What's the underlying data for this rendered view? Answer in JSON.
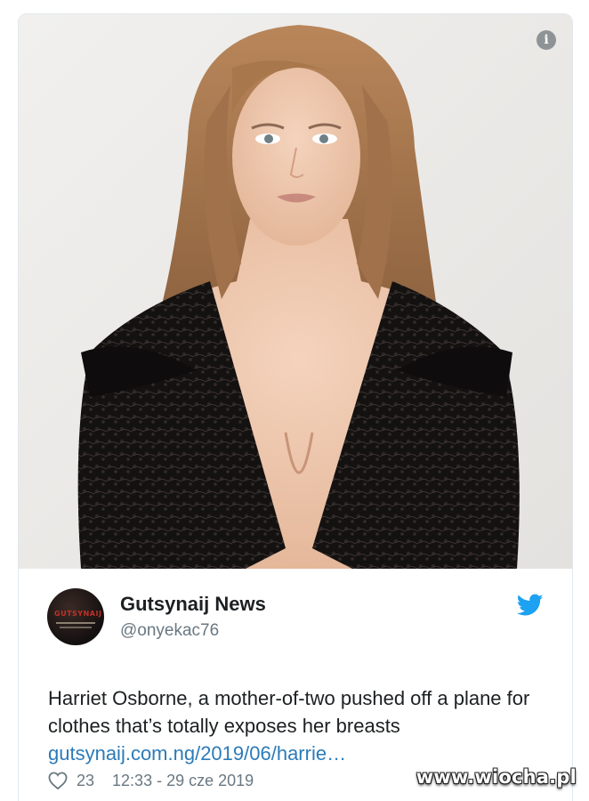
{
  "tweet": {
    "author": {
      "display_name": "Gutsynaij News",
      "handle": "@onyekac76",
      "avatar_text": "GUTSYNAIJ"
    },
    "text": {
      "body": "Harriet Osborne, a mother-of-two pushed off a plane for clothes that’s totally exposes her breasts ",
      "link": "gutsynaij.com.ng/2019/06/harrie…"
    },
    "likes": "23",
    "timestamp": "12:33 - 29 cze 2019"
  },
  "media": {
    "info_icon": "i"
  },
  "icons": {
    "info": "info-icon",
    "twitter": "twitter-bird-icon",
    "like": "heart-icon"
  },
  "colors": {
    "link": "#2b7bb9",
    "twitter_blue": "#1da1f2",
    "meta_gray": "#697882",
    "text": "#1c2022"
  },
  "watermark": "www.wiocha.pl"
}
